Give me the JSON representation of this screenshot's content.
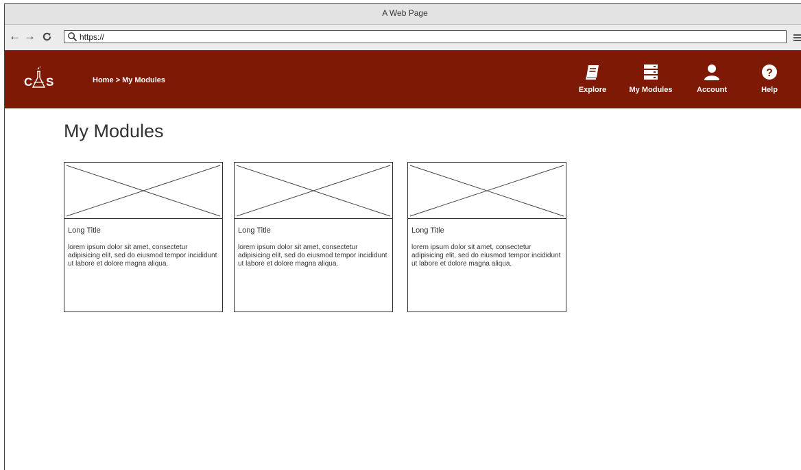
{
  "browser": {
    "window_title": "A Web Page",
    "back_icon": "arrow-left-icon",
    "forward_icon": "arrow-right-icon",
    "reload_icon": "reload-icon",
    "url_value": "https://",
    "menu_icon": "hamburger-menu-icon"
  },
  "header": {
    "background_color": "#7d1905",
    "logo": "CAS",
    "breadcrumb": "Home > My Modules",
    "nav": [
      {
        "label": "Explore",
        "icon": "book-icon"
      },
      {
        "label": "My Modules",
        "icon": "server-stack-icon"
      },
      {
        "label": "Account",
        "icon": "user-icon"
      },
      {
        "label": "Help",
        "icon": "help-icon"
      }
    ]
  },
  "main": {
    "title": "My Modules",
    "cards": [
      {
        "image": "image-placeholder",
        "title": "Long Title",
        "description": "lorem ipsum dolor sit amet, consectetur adipisicing elit, sed do eiusmod tempor incididunt ut labore et dolore magna aliqua."
      },
      {
        "image": "image-placeholder",
        "title": "Long Title",
        "description": "lorem ipsum dolor sit amet, consectetur adipisicing elit, sed do eiusmod tempor incididunt ut labore et dolore magna aliqua."
      },
      {
        "image": "image-placeholder",
        "title": "Long Title",
        "description": "lorem ipsum dolor sit amet, consectetur adipisicing elit, sed do eiusmod tempor incididunt ut labore et dolore magna aliqua."
      }
    ]
  }
}
